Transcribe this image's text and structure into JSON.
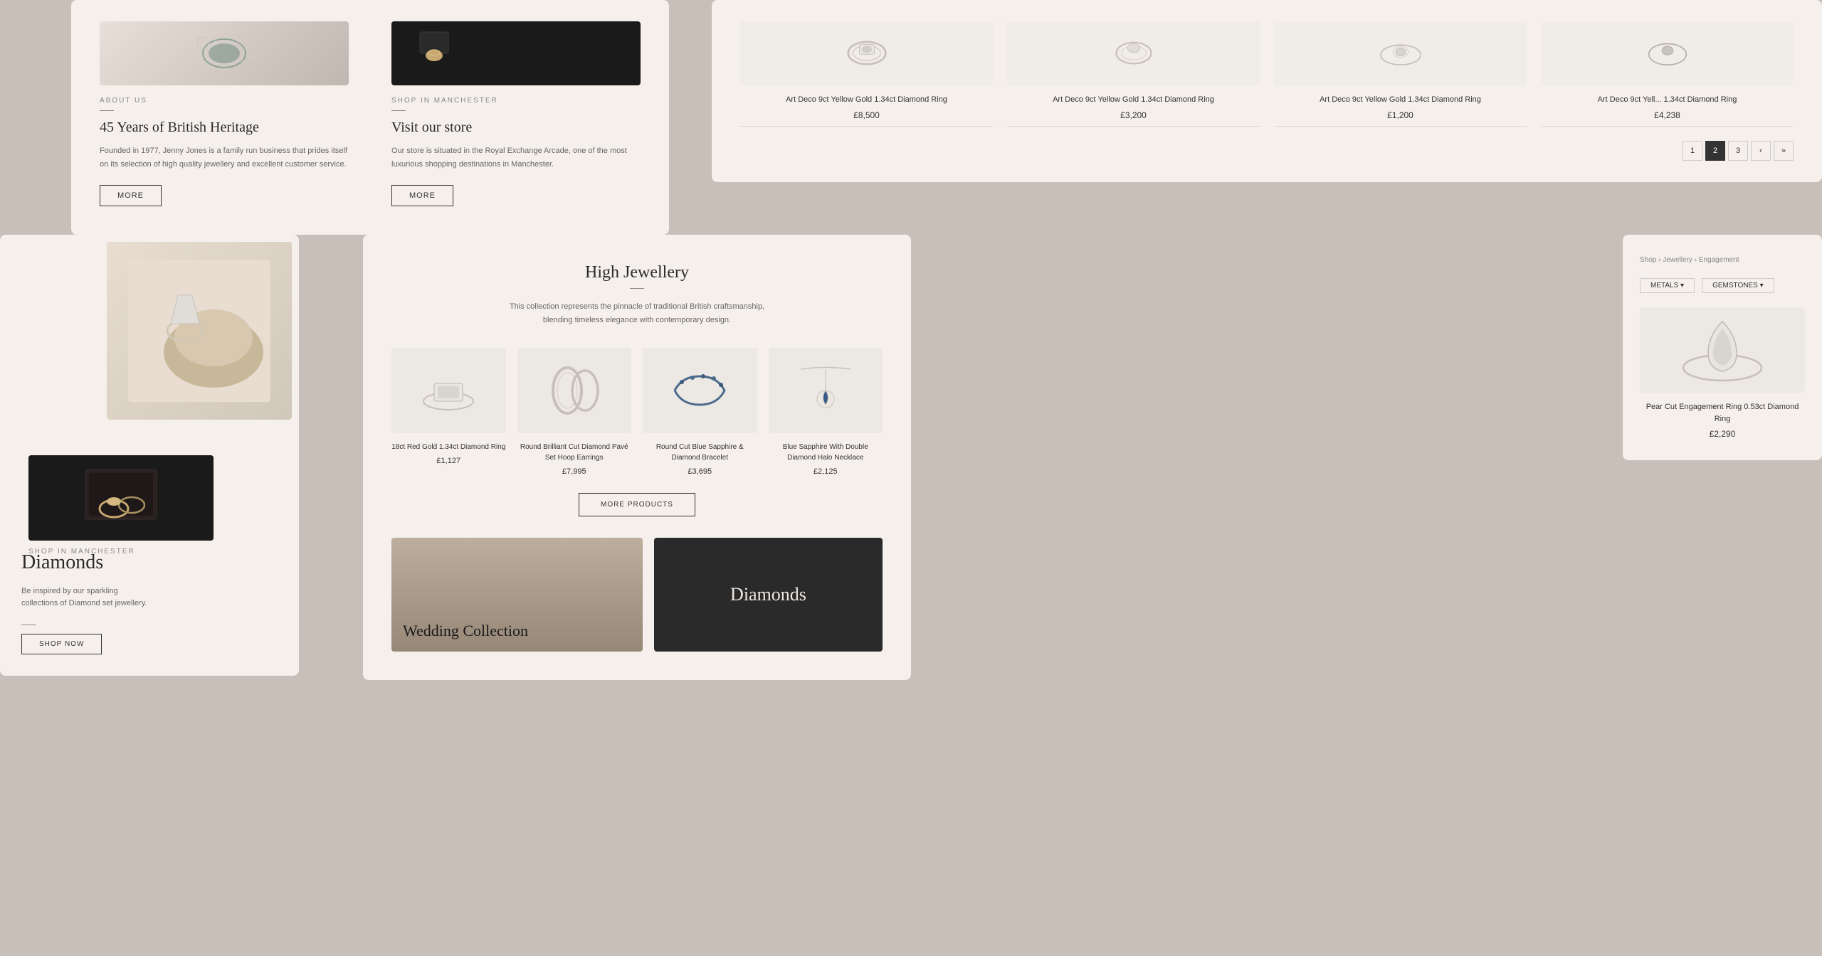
{
  "about": {
    "section1": {
      "label": "ABOUT US",
      "title": "45 Years of British Heritage",
      "text": "Founded in 1977, Jenny Jones is a family run business that prides itself on its selection of high quality jewellery and excellent customer service.",
      "btn": "MORE"
    },
    "section2": {
      "label": "SHOP IN MANCHESTER",
      "title": "Visit our store",
      "text": "Our store is situated in the Royal Exchange Arcade, one of the most luxurious shopping destinations in Manchester.",
      "btn": "MORE"
    }
  },
  "rings_panel": {
    "products": [
      {
        "name": "Art Deco 9ct Yellow Gold 1.34ct Diamond Ring",
        "price": "£8,500"
      },
      {
        "name": "Art Deco 9ct Yellow Gold 1.34ct Diamond Ring",
        "price": "£3,200"
      },
      {
        "name": "Art Deco 9ct Yellow Gold 1.34ct Diamond Ring",
        "price": "£1,200"
      },
      {
        "name": "Art Deco 9ct Yell... 1.34ct Diamond Ring",
        "price": "£4,238"
      }
    ],
    "pagination": {
      "pages": [
        "1",
        "2",
        "3"
      ],
      "active": "2",
      "prev": "‹",
      "next": "»"
    }
  },
  "diamonds_panel": {
    "title": "Diamonds",
    "subtitle": "Be inspired by our sparkling collections of Diamond set jewellery.",
    "btn": "SHOP NOW"
  },
  "high_jewellery": {
    "title": "High Jewellery",
    "description": "This collection represents the pinnacle of traditional British craftsmanship, blending timeless elegance with contemporary design.",
    "products": [
      {
        "name": "18ct Red Gold 1.34ct Diamond Ring",
        "price": "£1,127"
      },
      {
        "name": "Round Brilliant Cut Diamond Pavé Set Hoop Earrings",
        "price": "£7,995"
      },
      {
        "name": "Round Cut Blue Sapphire & Diamond Bracelet",
        "price": "£3,695"
      },
      {
        "name": "Blue Sapphire With Double Diamond Halo Necklace",
        "price": "£2,125"
      }
    ],
    "btn": "MORE PRODUCTS"
  },
  "wedding_banner": {
    "title": "Wedding Collection"
  },
  "diamonds_banner": {
    "title": "Diamonds"
  },
  "detail_panel": {
    "breadcrumb": "Shop › Jewellery › Engagement",
    "filters": [
      "METALS ▾",
      "GEMSTONES ▾"
    ],
    "product": {
      "name": "Pear Cut Engagement Ring 0.53ct Diamond Ring",
      "price": "£2,290"
    }
  },
  "shop_manchester": {
    "label": "SHOP IN MANCHESTER"
  },
  "colors": {
    "background": "#c8bfb8",
    "panel": "#f5f0ec",
    "accent": "#333333",
    "text_muted": "#888888"
  }
}
